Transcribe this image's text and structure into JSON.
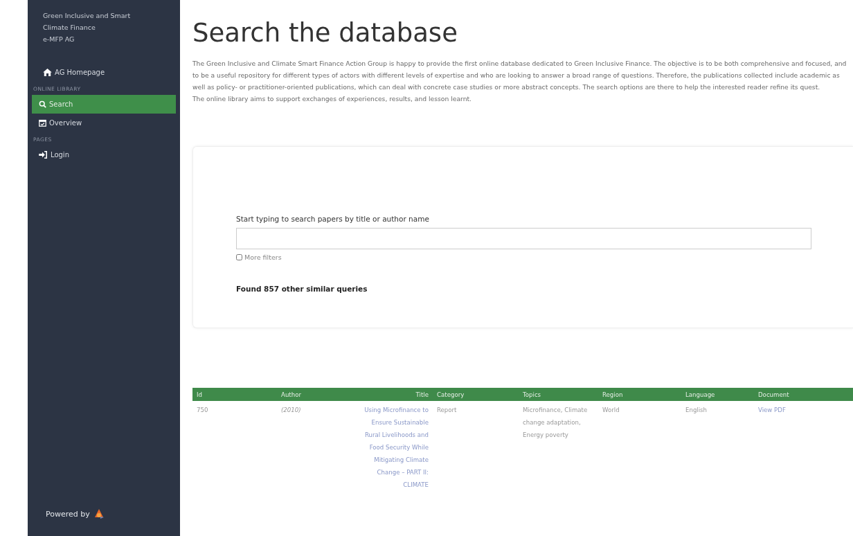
{
  "sidebar": {
    "brand": [
      "Green Inclusive and Smart",
      "Climate Finance",
      "e-MFP AG"
    ],
    "items": [
      {
        "kind": "link",
        "label": "AG Homepage",
        "selected": false
      },
      {
        "kind": "heading",
        "label": "ONLINE LIBRARY"
      },
      {
        "kind": "link",
        "label": "Search",
        "selected": true
      },
      {
        "kind": "link",
        "label": "Overview",
        "selected": false
      },
      {
        "kind": "heading",
        "label": "PAGES"
      },
      {
        "kind": "link",
        "label": "Login",
        "selected": false
      }
    ],
    "footer": "Powered by"
  },
  "page": {
    "title": "Search the database",
    "paragraphs": [
      "The Green Inclusive and Climate Smart Finance Action Group is happy to provide the first online database dedicated to Green Inclusive Finance. The objective is to be both comprehensive and focused, and to be a useful repository for different types of actors with different levels of expertise and who are looking to answer a broad range of questions. Therefore, the publications collected include academic as well as policy- or practitioner-oriented publications, which can deal with concrete case studies or more abstract concepts. The search options are there to help the interested reader refine its quest.",
      "The online library aims to support exchanges of experiences, results, and lesson learnt."
    ]
  },
  "search": {
    "label": "Start typing to search papers by title or author name",
    "more_filters": {
      "label": "More filters",
      "checked": false
    },
    "result": "Found 857 other similar queries"
  },
  "table": {
    "columns": [
      "Id",
      "Author",
      "Title",
      "Category",
      "Topics",
      "Region",
      "Language",
      "Document"
    ],
    "rows": [
      {
        "id": "750",
        "author": "(2010)",
        "title": "Using Microfinance to Ensure Sustainable Rural Livelihoods and Food Security While Mitigating Climate Change – PART II: CLIMATE",
        "category": "Report",
        "topics": [
          "Microfinance,",
          "Climate change adaptation,",
          "Energy poverty"
        ],
        "region": "World",
        "language": "English",
        "document": "View PDF"
      }
    ]
  }
}
